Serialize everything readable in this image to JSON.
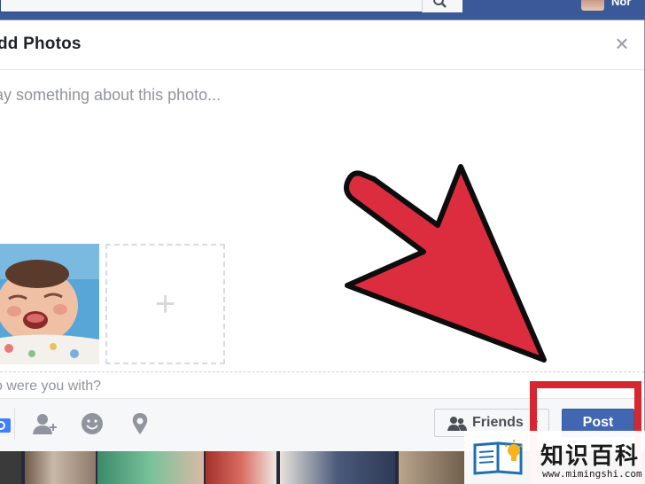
{
  "topbar": {
    "username": "Nor"
  },
  "dialog": {
    "title": "dd Photos",
    "close_symbol": "×",
    "post_placeholder": "ay something about this photo...",
    "add_photo_symbol": "+",
    "tag_placeholder": "o were you with?",
    "footer": {
      "audience_label": "Friends",
      "audience_caret": "▾",
      "post_label": "Post"
    }
  },
  "annotation": {
    "arrow_color": "#dc2d3f",
    "box_color": "#d6262f"
  },
  "watermark": {
    "title": "知识百科",
    "url": "www.mimingshi.com"
  },
  "colors": {
    "facebook_blue": "#3b5998",
    "post_button": "#4267b2"
  },
  "icons": [
    "search-icon",
    "close-icon",
    "camera-icon",
    "tag-friend-icon",
    "feeling-icon",
    "location-icon",
    "friends-icon",
    "book-lightbulb-icon"
  ]
}
